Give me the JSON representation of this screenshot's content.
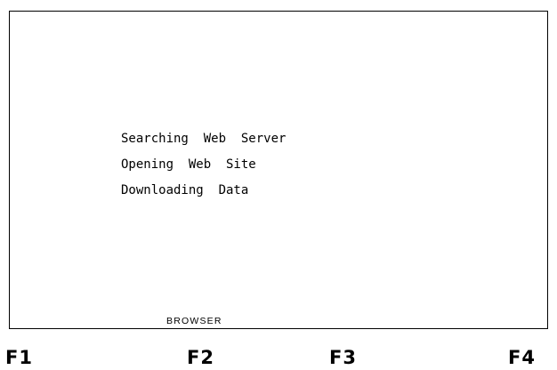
{
  "screen": {
    "status_lines": [
      "Searching  Web  Server",
      "Opening  Web  Site",
      "Downloading  Data"
    ],
    "mode_label": "BROWSER"
  },
  "function_keys": [
    "F1",
    "F2",
    "F3",
    "F4"
  ],
  "colors": {
    "background": "#ffffff",
    "text": "#000000",
    "border": "#000000"
  }
}
